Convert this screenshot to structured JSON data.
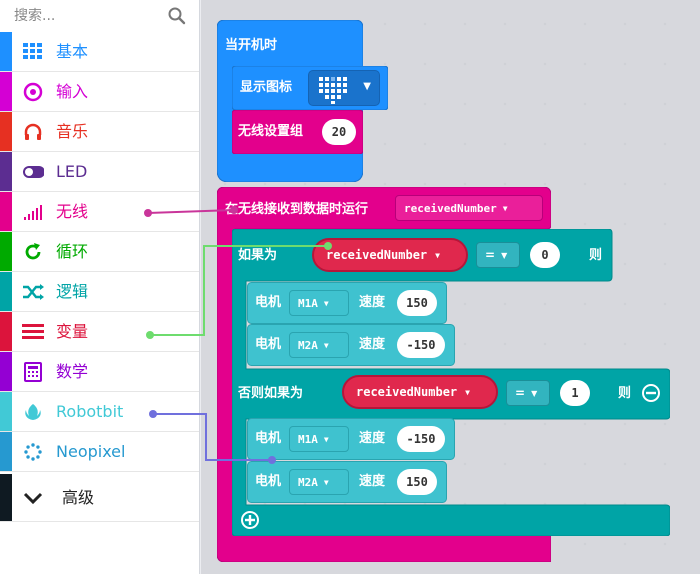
{
  "search": {
    "placeholder": "搜索..."
  },
  "categories": [
    {
      "label": "基本",
      "color": "#1e90ff",
      "icon": "grid-icon"
    },
    {
      "label": "输入",
      "color": "#d400d4",
      "icon": "target-icon"
    },
    {
      "label": "音乐",
      "color": "#e63022",
      "icon": "headphones-icon"
    },
    {
      "label": "LED",
      "color": "#5c2d91",
      "icon": "toggle-icon"
    },
    {
      "label": "无线",
      "color": "#e3008c",
      "icon": "signal-bars-icon"
    },
    {
      "label": "循环",
      "color": "#00aa00",
      "icon": "refresh-icon"
    },
    {
      "label": "逻辑",
      "color": "#00a4a6",
      "icon": "shuffle-icon"
    },
    {
      "label": "变量",
      "color": "#dc143c",
      "icon": "lines-icon"
    },
    {
      "label": "数学",
      "color": "#9400d3",
      "icon": "calculator-icon"
    },
    {
      "label": "Robotbit",
      "color": "#41c9d6",
      "icon": "rebel-icon"
    },
    {
      "label": "Neopixel",
      "color": "#2699d0",
      "icon": "dots-circle-icon"
    }
  ],
  "advanced": {
    "label": "高级"
  },
  "blocks": {
    "on_start": {
      "label": "当开机时"
    },
    "show_icon": {
      "label": "显示图标"
    },
    "radio_group": {
      "label": "无线设置组",
      "value": "20"
    },
    "on_received": {
      "label": "在无线接收到数据时运行",
      "param": "receivedNumber"
    },
    "if1": {
      "label": "如果为",
      "var": "receivedNumber",
      "op": "=",
      "value": "0",
      "then": "则"
    },
    "motor1": {
      "label": "电机",
      "port": "M1A",
      "speed_label": "速度",
      "speed": "150"
    },
    "motor2": {
      "label": "电机",
      "port": "M2A",
      "speed_label": "速度",
      "speed": "-150"
    },
    "elseif": {
      "label": "否则如果为",
      "var": "receivedNumber",
      "op": "=",
      "value": "1",
      "then": "则"
    },
    "motor3": {
      "label": "电机",
      "port": "M1A",
      "speed_label": "速度",
      "speed": "-150"
    },
    "motor4": {
      "label": "电机",
      "port": "M2A",
      "speed_label": "速度",
      "speed": "150"
    }
  }
}
